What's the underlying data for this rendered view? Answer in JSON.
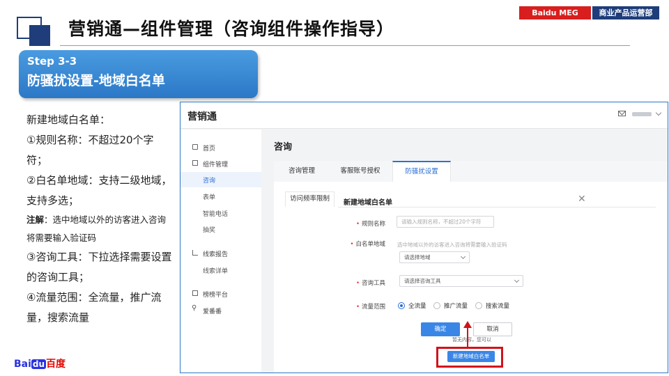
{
  "header": {
    "title": "营销通—组件管理（咨询组件操作指导）",
    "badge_left": "Baidu MEG",
    "badge_right": "商业产品运营部"
  },
  "step": {
    "number": "Step 3-3",
    "name": "防骚扰设置-地域白名单"
  },
  "instructions": {
    "intro": "新建地域白名单：",
    "item1": "①规则名称：不超过20个字符；",
    "item2": "②白名单地域：支持二级地域，支持多选；",
    "note_label": "注解",
    "note_text": "：选中地域以外的访客进入咨询将需要输入验证码",
    "item3": "③咨询工具：下拉选择需要设置的咨询工具；",
    "item4": "④流量范围：全流量，推广流量，搜索流量"
  },
  "logo": {
    "bai": "Bai",
    "du": "du",
    "cn": "百度"
  },
  "app": {
    "name": "营销通",
    "content_title": "咨询",
    "sidebar": [
      {
        "label": "首页",
        "icon": "home-icon"
      },
      {
        "label": "组件管理",
        "icon": "component-icon"
      },
      {
        "label": "咨询",
        "sub": true,
        "active": true
      },
      {
        "label": "表单",
        "sub": true
      },
      {
        "label": "智能电话",
        "sub": true
      },
      {
        "label": "抽奖",
        "sub": true
      },
      {
        "label": "线索报告",
        "icon": "chart-icon"
      },
      {
        "label": "线索详单",
        "sub": true
      },
      {
        "label": "榜榜平台",
        "icon": "platform-icon"
      },
      {
        "label": "爱番番",
        "icon": "share-icon"
      }
    ],
    "tabs": [
      "咨询管理",
      "客服账号授权",
      "防骚扰设置"
    ],
    "subtab": "访问频率限制",
    "dialog": {
      "title": "新建地域白名单",
      "close": "✕",
      "rule_name_label": "规则名称",
      "rule_name_placeholder": "请输入规则名称，不超过20个字符",
      "region_label": "白名单地域",
      "region_hint": "选中地域以外的访客进入咨询将需要输入验证码",
      "region_select": "请选择地域",
      "tool_label": "咨询工具",
      "tool_select": "请选择咨询工具",
      "traffic_label": "流量范围",
      "traffic_options": [
        "全流量",
        "推广流量",
        "搜索流量"
      ],
      "confirm": "确定",
      "cancel": "取消",
      "under_text": "暂无内容，您可以",
      "new_button": "新建地域白名单"
    }
  }
}
